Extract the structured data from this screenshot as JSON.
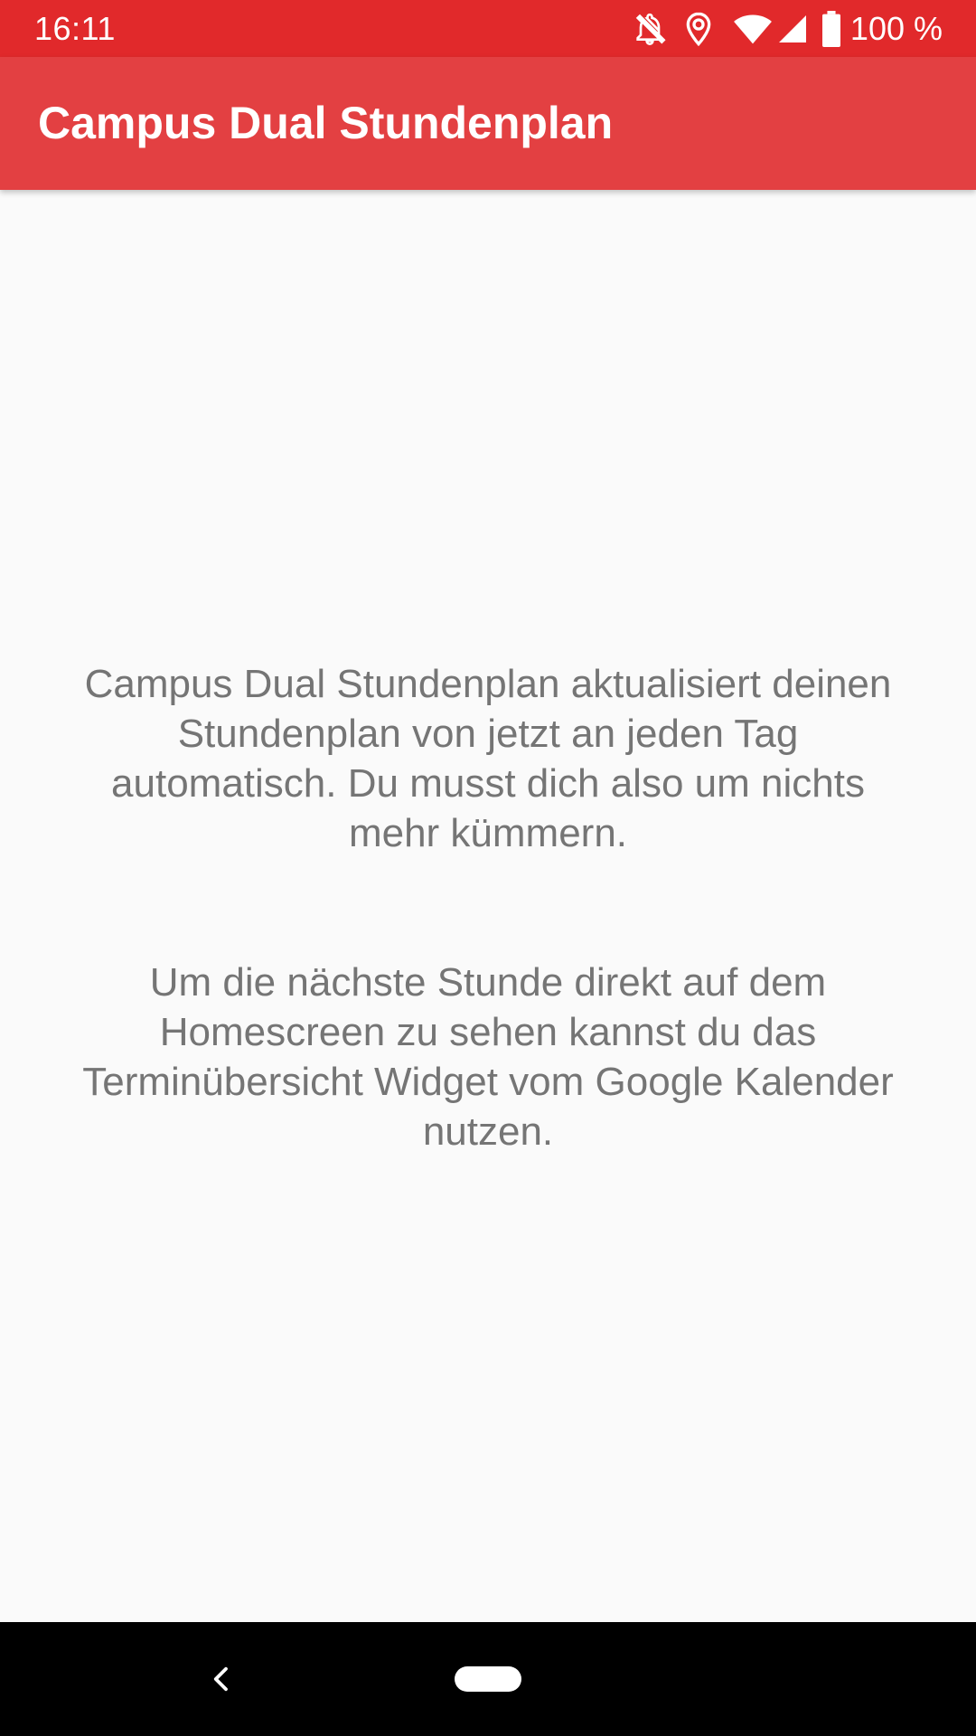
{
  "status_bar": {
    "time": "16:11",
    "battery": "100 %",
    "icons": [
      "notifications-off-icon",
      "location-icon",
      "wifi-icon",
      "cell-signal-icon",
      "battery-icon"
    ],
    "background": "#e1292b"
  },
  "app_bar": {
    "title": "Campus Dual Stundenplan",
    "background": "#e34042"
  },
  "content": {
    "paragraph_1": "Campus Dual Stundenplan aktualisiert deinen Stundenplan von jetzt an jeden Tag automatisch. Du musst dich also um nichts mehr kümmern.",
    "paragraph_2": "Um die nächste Stunde direkt auf dem Homescreen zu sehen kannst du das Terminübersicht Widget vom Google Kalender nutzen.",
    "text_color": "#757575"
  },
  "nav_bar": {
    "icons": [
      "back-icon",
      "home-pill-icon"
    ]
  }
}
